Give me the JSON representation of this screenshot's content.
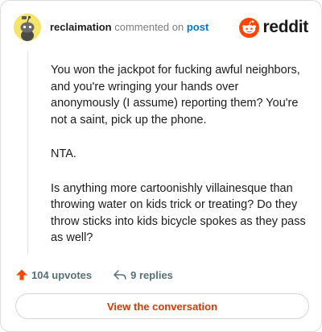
{
  "header": {
    "username": "reclaimation",
    "verb": "commented on",
    "post_link": "post",
    "brand": "reddit"
  },
  "comment": {
    "paragraphs": [
      "You won the jackpot for fucking awful neighbors, and you're wringing your hands over anonymously (I assume) reporting them? You're not a saint, pick up the phone.",
      "NTA.",
      "Is anything more cartoonishly villainesque than throwing water on kids trick or treating? Do they throw sticks into kids bicycle spokes as they pass as well?"
    ]
  },
  "actions": {
    "upvotes_label": "104 upvotes",
    "replies_label": "9 replies"
  },
  "cta": {
    "label": "View the conversation"
  },
  "colors": {
    "upvote": "#ff4500",
    "link": "#0079d3",
    "cta_text": "#d93a00",
    "avatar_bg": "#f5e46b"
  },
  "icons": {
    "avatar": "snoo-avatar-icon",
    "brand": "reddit-logo-icon",
    "upvote": "upvote-arrow-icon",
    "reply": "reply-arrow-icon"
  }
}
